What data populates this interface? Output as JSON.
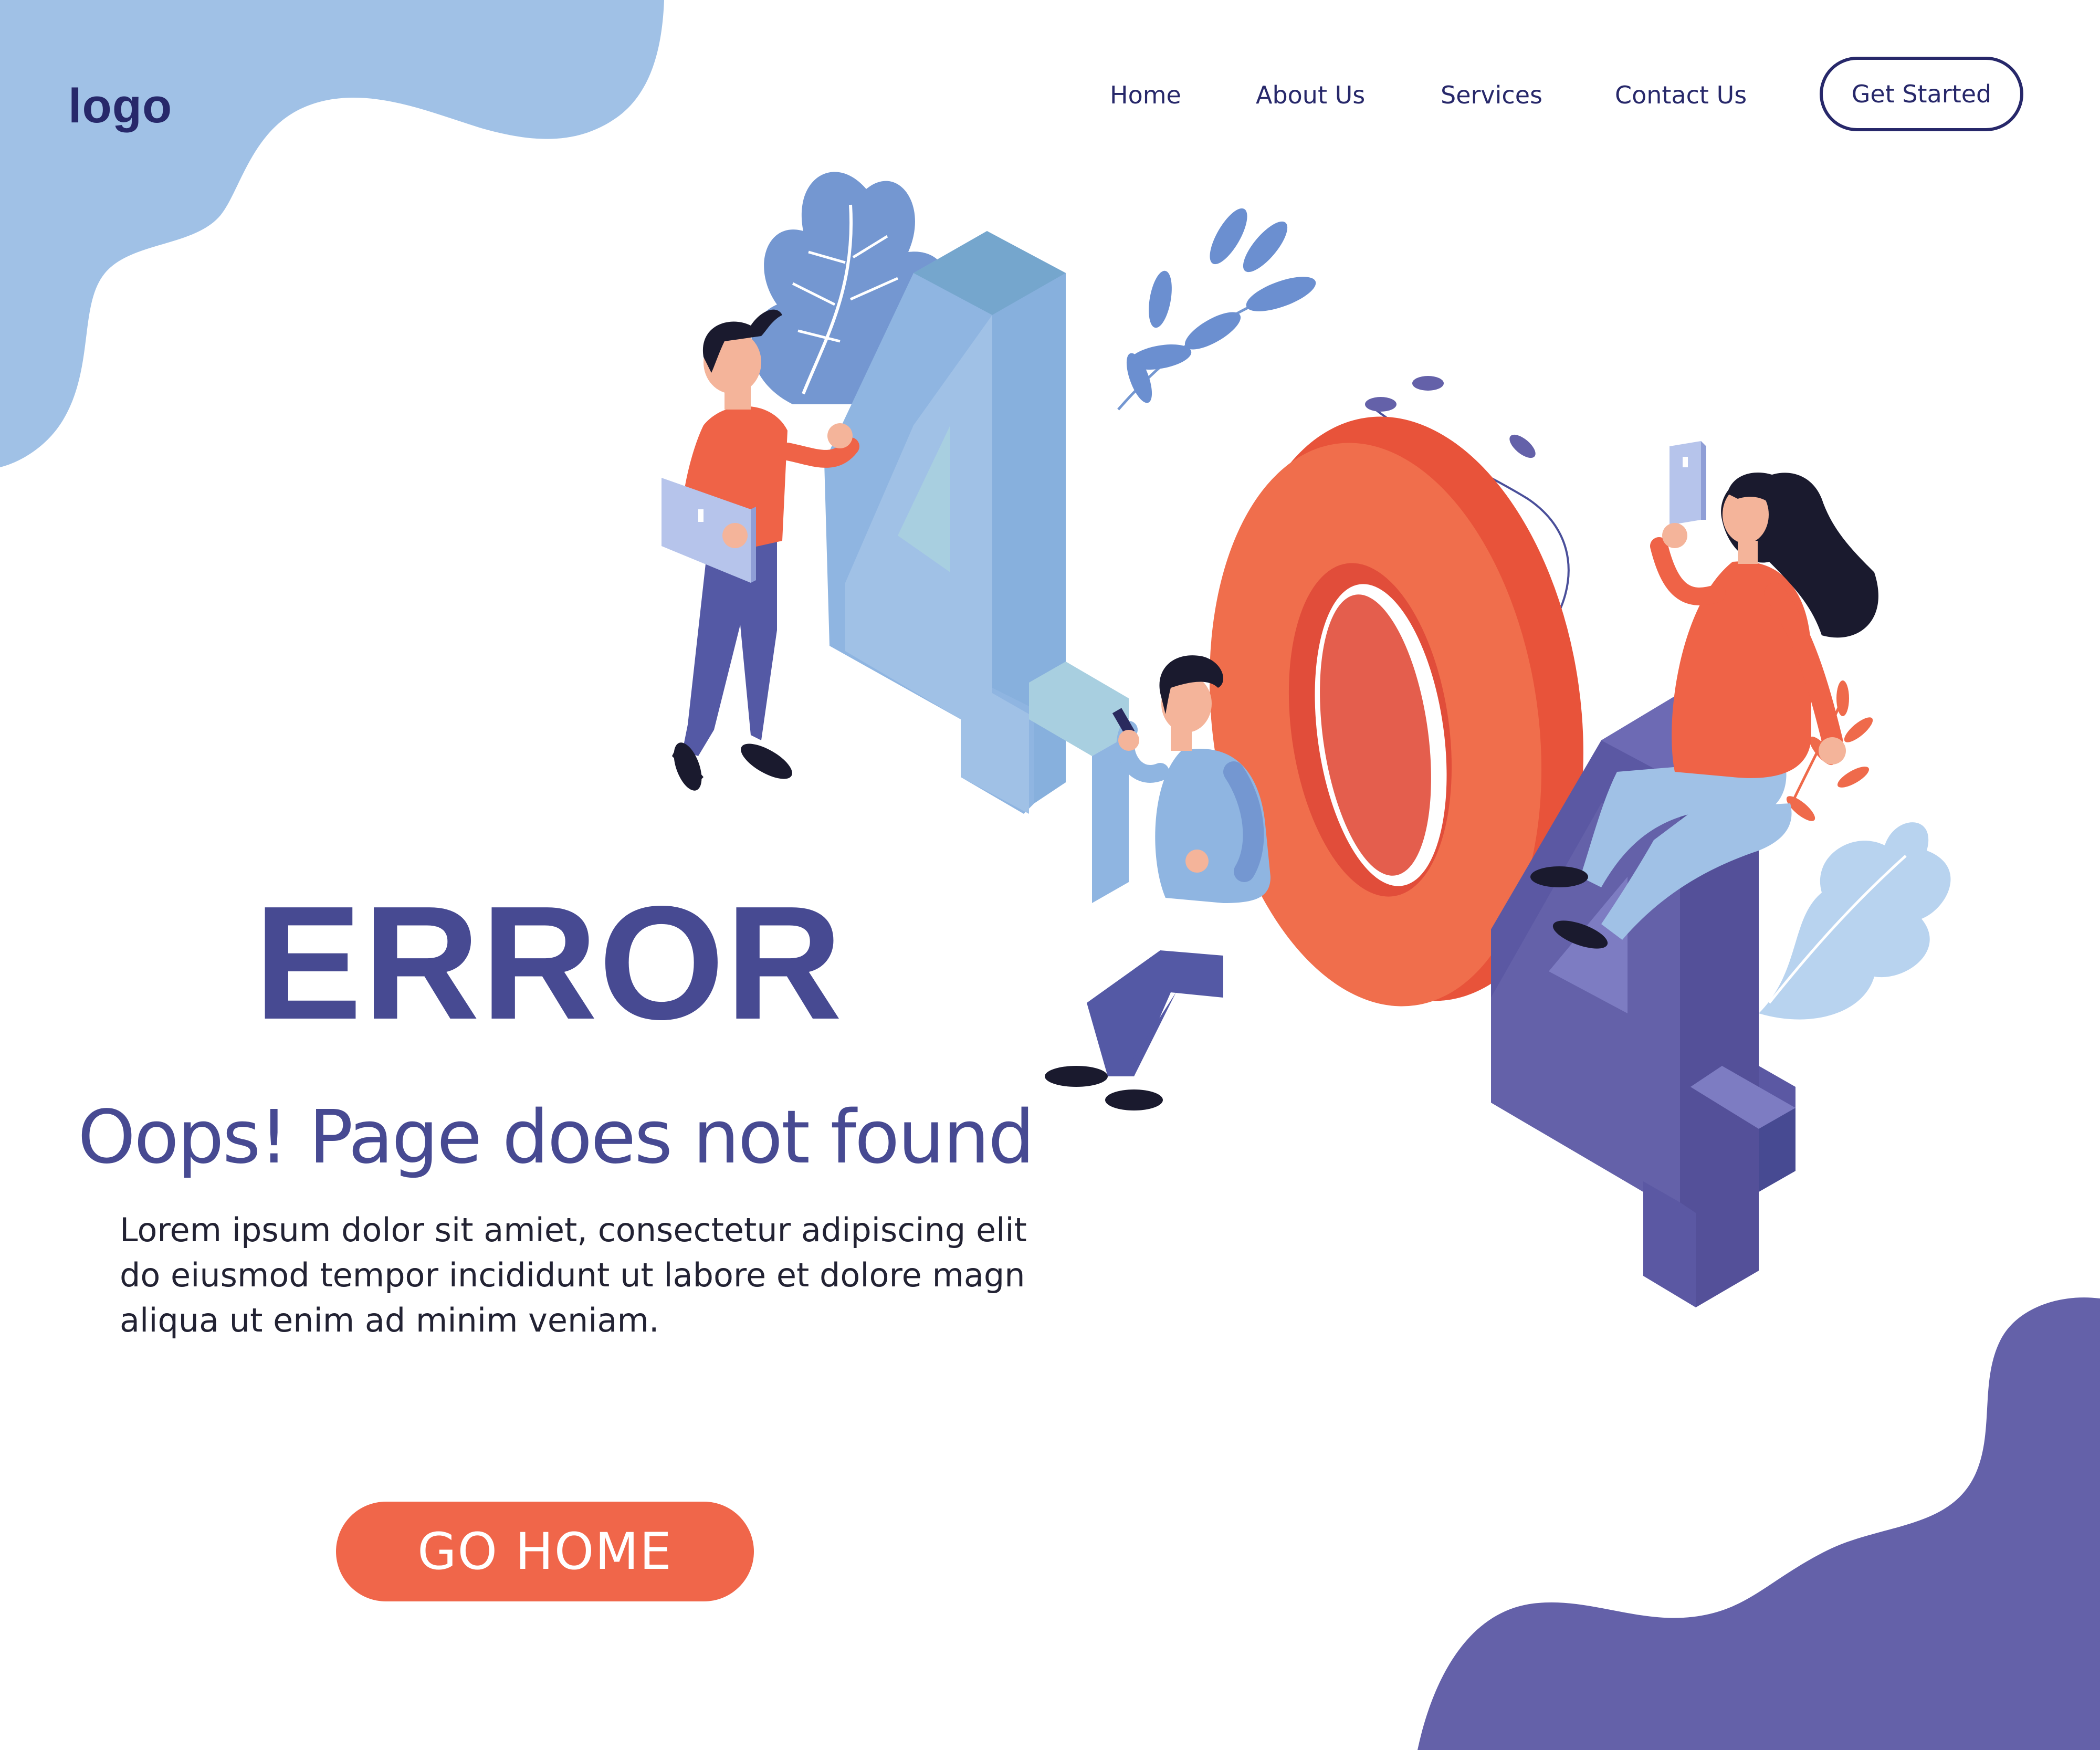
{
  "header": {
    "logo": "logo",
    "nav": {
      "home": "Home",
      "about": "About Us",
      "services": "Services",
      "contact": "Contact Us"
    },
    "cta": "Get Started"
  },
  "hero": {
    "title": "ERROR",
    "subtitle": "Oops! Page does not found",
    "body_lines": [
      "Lorem ipsum dolor sit amiet, consectetur adipiscing elit",
      "do eiusmod tempor incididunt ut labore et dolore magn",
      "aliqua ut enim ad minim veniam."
    ],
    "button": "GO HOME"
  },
  "illustration": {
    "digits": [
      "4",
      "0",
      "4"
    ],
    "icons": [
      "leaf-icon",
      "tablet-icon",
      "phone-icon",
      "person-icon"
    ]
  },
  "colors": {
    "navy": "#27286a",
    "title_purple": "#474a92",
    "accent_orange": "#f0664a",
    "blob_light_blue": "#a0c1e6",
    "blob_purple": "#6461a9"
  }
}
